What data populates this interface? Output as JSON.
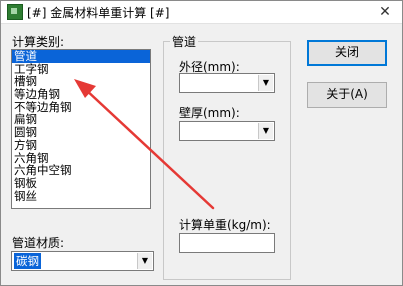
{
  "window": {
    "title": "[#] 金属材料单重计算 [#]",
    "close_glyph": "✕"
  },
  "category": {
    "label": "计算类别:",
    "items": [
      "管道",
      "工字钢",
      "槽钢",
      "等边角钢",
      "不等边角钢",
      "扁钢",
      "圆钢",
      "方钢",
      "六角钢",
      "六角中空钢",
      "钢板",
      "钢丝"
    ],
    "selected_index": 0
  },
  "material": {
    "label": "管道材质:",
    "value": "碳钢"
  },
  "pipe_group": {
    "title": "管道",
    "outer_diameter_label": "外径(mm):",
    "outer_diameter_value": "",
    "wall_thickness_label": "壁厚(mm):",
    "wall_thickness_value": "",
    "unit_weight_label": "计算单重(kg/m):",
    "unit_weight_value": ""
  },
  "buttons": {
    "close": "关闭",
    "about": "关于(A)"
  },
  "annotation": {
    "color": "#e53935"
  }
}
